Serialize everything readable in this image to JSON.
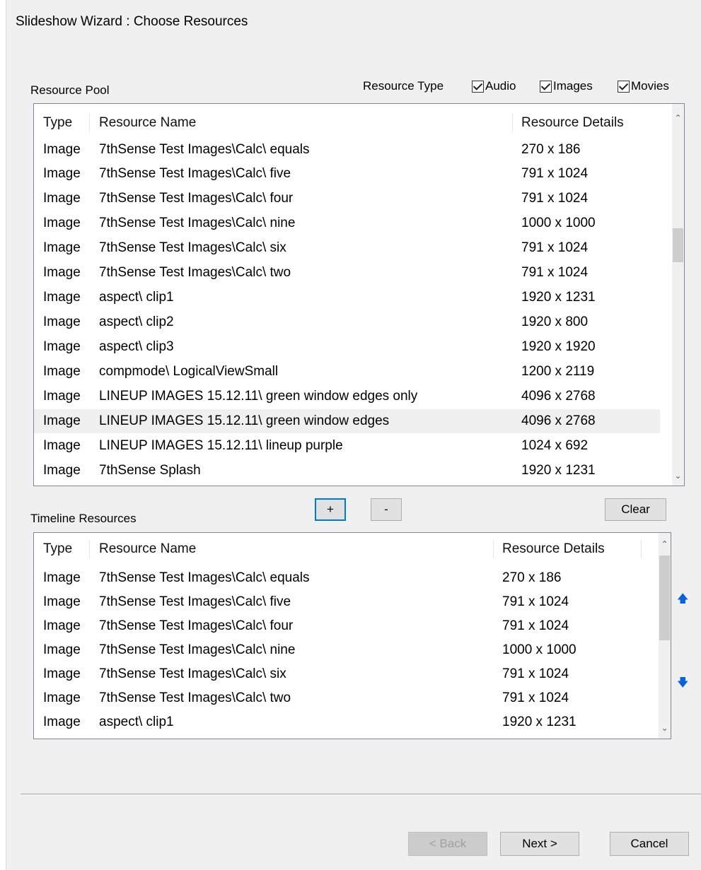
{
  "window": {
    "title": "Slideshow Wizard : Choose Resources"
  },
  "resource_pool": {
    "label": "Resource Pool",
    "filter_label": "Resource Type",
    "filters": [
      {
        "label": "Audio",
        "checked": true
      },
      {
        "label": "Images",
        "checked": true
      },
      {
        "label": "Movies",
        "checked": true
      }
    ],
    "columns": [
      "Type",
      "Resource Name",
      "Resource Details"
    ],
    "rows": [
      {
        "type": "Image",
        "name": "7thSense Test Images\\Calc\\ equals",
        "details": "270 x 186"
      },
      {
        "type": "Image",
        "name": "7thSense Test Images\\Calc\\ five",
        "details": "791 x 1024"
      },
      {
        "type": "Image",
        "name": "7thSense Test Images\\Calc\\ four",
        "details": "791 x 1024"
      },
      {
        "type": "Image",
        "name": "7thSense Test Images\\Calc\\ nine",
        "details": "1000 x 1000"
      },
      {
        "type": "Image",
        "name": "7thSense Test Images\\Calc\\ six",
        "details": "791 x 1024"
      },
      {
        "type": "Image",
        "name": "7thSense Test Images\\Calc\\ two",
        "details": "791 x 1024"
      },
      {
        "type": "Image",
        "name": "aspect\\ clip1",
        "details": "1920 x 1231"
      },
      {
        "type": "Image",
        "name": "aspect\\ clip2",
        "details": "1920 x 800"
      },
      {
        "type": "Image",
        "name": "aspect\\ clip3",
        "details": "1920 x 1920"
      },
      {
        "type": "Image",
        "name": "compmode\\ LogicalViewSmall",
        "details": "1200 x 2119"
      },
      {
        "type": "Image",
        "name": "LINEUP IMAGES 15.12.11\\ green window edges only",
        "details": "4096 x 2768"
      },
      {
        "type": "Image",
        "name": "LINEUP IMAGES 15.12.11\\ green window edges",
        "details": "4096 x 2768"
      },
      {
        "type": "Image",
        "name": "LINEUP IMAGES 15.12.11\\ lineup purple",
        "details": "1024 x 692"
      },
      {
        "type": "Image",
        "name": " 7thSense Splash",
        "details": "1920 x 1231"
      }
    ]
  },
  "pool_buttons": {
    "add": "+",
    "remove": "-",
    "clear": "Clear"
  },
  "timeline": {
    "label": "Timeline Resources",
    "columns": [
      "Type",
      "Resource Name",
      "Resource Details"
    ],
    "rows": [
      {
        "type": "Image",
        "name": "7thSense Test Images\\Calc\\ equals",
        "details": "270 x 186"
      },
      {
        "type": "Image",
        "name": "7thSense Test Images\\Calc\\ five",
        "details": "791 x 1024"
      },
      {
        "type": "Image",
        "name": "7thSense Test Images\\Calc\\ four",
        "details": "791 x 1024"
      },
      {
        "type": "Image",
        "name": "7thSense Test Images\\Calc\\ nine",
        "details": "1000 x 1000"
      },
      {
        "type": "Image",
        "name": "7thSense Test Images\\Calc\\ six",
        "details": "791 x 1024"
      },
      {
        "type": "Image",
        "name": "7thSense Test Images\\Calc\\ two",
        "details": "791 x 1024"
      },
      {
        "type": "Image",
        "name": "aspect\\ clip1",
        "details": "1920 x 1231"
      }
    ],
    "move_up": "🡅",
    "move_down": "🡇"
  },
  "footer": {
    "back": "< Back",
    "next": "Next >",
    "cancel": "Cancel"
  },
  "colors": {
    "accent": "#0078d7",
    "arrow_blue": "#0a62d8",
    "dialog_bg": "#f0f0f0"
  }
}
